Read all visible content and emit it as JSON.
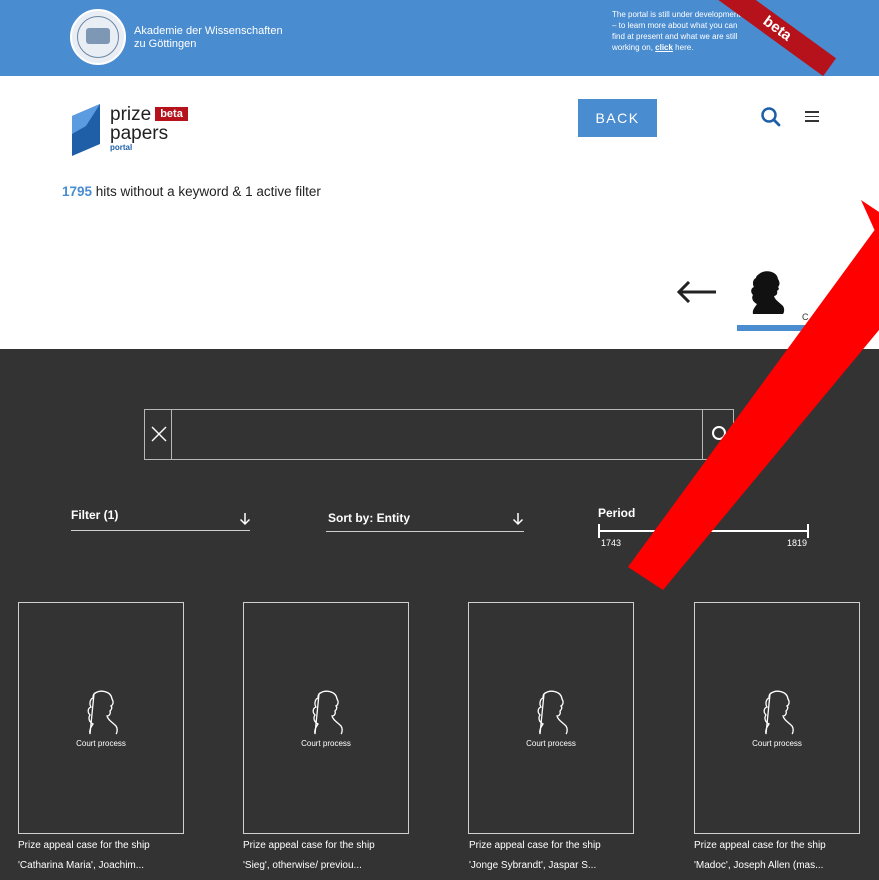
{
  "banner": {
    "academy_line1": "Akademie der Wissenschaften",
    "academy_line2": "zu Göttingen",
    "beta_note_text": "The portal is still under development – to learn more about what you can find at present and what we are still working on,",
    "beta_note_link": "click",
    "beta_note_suffix": " here.",
    "ribbon": "beta"
  },
  "header": {
    "logo_line1": "prize",
    "logo_badge": "beta",
    "logo_line2": "papers",
    "logo_line3": "portal",
    "back_label": "BACK"
  },
  "results": {
    "count": "1795",
    "summary": " hits without a keyword & 1 active filter"
  },
  "entity_tab": {
    "label_visible": "C",
    "label_suffix": "ss"
  },
  "search": {
    "value": ""
  },
  "controls": {
    "filter_label": "Filter (1)",
    "sort_label": "Sort by: Entity",
    "period_label": "Period",
    "period_start": "1743",
    "period_end": "1819"
  },
  "cards": [
    {
      "caption": "Court process",
      "title1": "Prize appeal case for the ship",
      "title2": "'Catharina Maria', Joachim..."
    },
    {
      "caption": "Court process",
      "title1": "Prize appeal case for the ship",
      "title2": "'Sieg', otherwise/ previou..."
    },
    {
      "caption": "Court process",
      "title1": "Prize appeal case for the ship",
      "title2": "'Jonge Sybrandt', Jaspar S..."
    },
    {
      "caption": "Court process",
      "title1": "Prize appeal case for the ship",
      "title2": "'Madoc', Joseph Allen (mas..."
    }
  ],
  "colors": {
    "accent_blue": "#4a8cd0",
    "ribbon_red": "#b5121b",
    "dark_panel": "#333333",
    "overlay_red": "#ff0000"
  }
}
